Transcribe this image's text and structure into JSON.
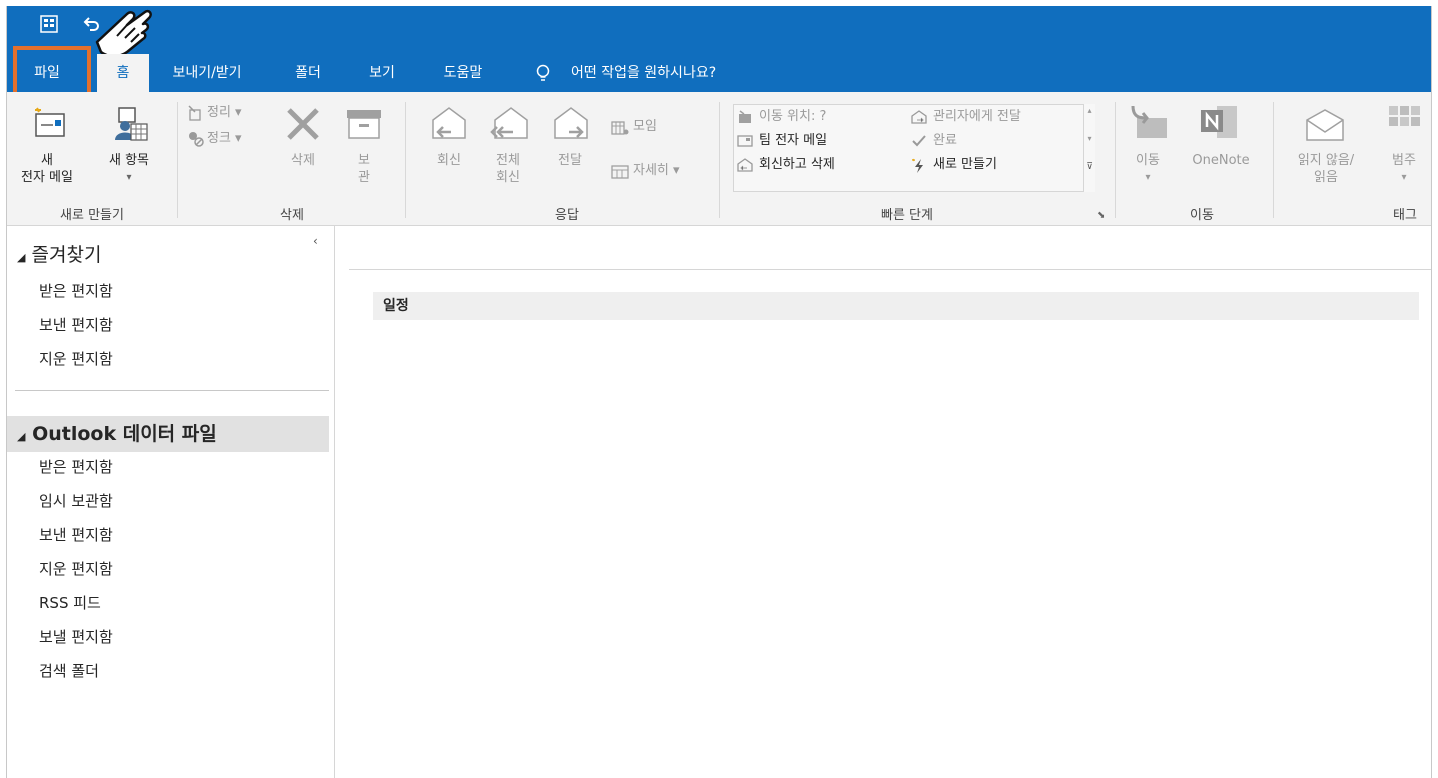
{
  "qat": {
    "save_icon": "outlook-qat-icon",
    "undo_icon": "undo-icon"
  },
  "tabs": {
    "file": "파일",
    "home": "홈",
    "send_receive": "보내기/받기",
    "folder": "폴더",
    "view": "보기",
    "help": "도움말",
    "tell_me": "어떤 작업을 원하시나요?"
  },
  "ribbon": {
    "new_group": {
      "new_email_line1": "새",
      "new_email_line2": "전자 메일",
      "new_items_line1": "새 항목",
      "new_items_line2": "▾",
      "label": "새로 만들기"
    },
    "delete_group": {
      "cleanup": "정리 ▾",
      "junk": "정크 ▾",
      "delete": "삭제",
      "archive_line1": "보",
      "archive_line2": "관",
      "label": "삭제"
    },
    "respond_group": {
      "reply": "회신",
      "reply_all_line1": "전체",
      "reply_all_line2": "회신",
      "forward": "전달",
      "meeting": "모임",
      "more": "자세히 ▾",
      "label": "응답"
    },
    "quick_steps": {
      "move_to": "이동 위치: ?",
      "team_email": "팀 전자 메일",
      "reply_delete": "회신하고 삭제",
      "to_manager": "관리자에게 전달",
      "done": "완료",
      "create_new": "새로 만들기",
      "label": "빠른 단계"
    },
    "move_group": {
      "move": "이동",
      "onenote": "OneNote",
      "label": "이동"
    },
    "tags_group": {
      "unread_read_line1": "읽지 않음/",
      "unread_read_line2": "읽음",
      "categorize": "범주",
      "label": "태그"
    }
  },
  "folder_pane": {
    "favorites_title": "즐겨찾기",
    "favorites": [
      "받은 편지함",
      "보낸 편지함",
      "지운 편지함"
    ],
    "data_file_title_bold": "Outlook",
    "data_file_title_rest": " 데이터 파일",
    "data_file_folders": [
      "받은 편지함",
      "임시 보관함",
      "보낸 편지함",
      "지운 편지함",
      "RSS 피드",
      "보낼 편지함",
      "검색 폴더"
    ]
  },
  "content": {
    "calendar_header": "일정"
  },
  "colors": {
    "accent": "#106ebe",
    "highlight": "#e3702d",
    "ribbon_bg": "#f3f3f3"
  }
}
